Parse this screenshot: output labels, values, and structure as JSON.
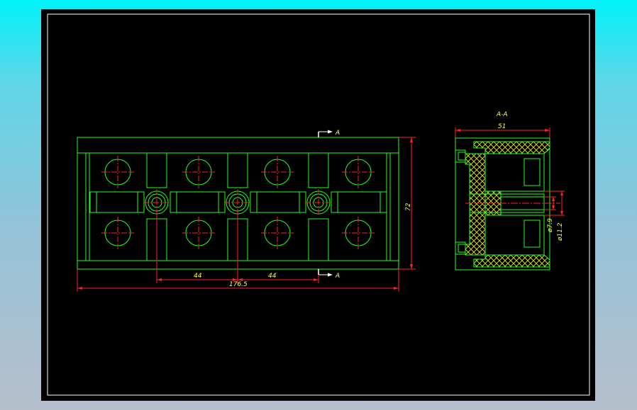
{
  "colors": {
    "background_gradient_top": "#00f2fa",
    "background_gradient_bottom": "#b6bfcc",
    "sheet": "#000000",
    "frame": "#ffffff",
    "outline": "#22ff22",
    "centerline": "#ff2222",
    "dimension": "#ff2222",
    "text": "#ffff33",
    "hatch": "#cccc33"
  },
  "section_marks": {
    "top_label": "A",
    "bottom_label": "A"
  },
  "dimensions": {
    "pitch_1": "44",
    "pitch_2": "44",
    "overall_length": "176.5",
    "height": "72"
  },
  "section_view": {
    "title": "A-A",
    "width": "51",
    "bore_small": "ø7.9",
    "bore_large": "ø11.2"
  }
}
